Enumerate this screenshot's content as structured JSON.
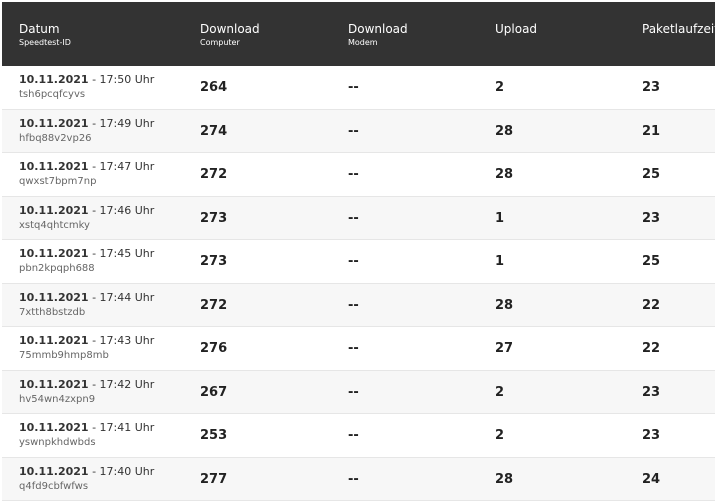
{
  "header": {
    "col_date": "Datum",
    "col_date_sub": "Speedtest-ID",
    "col_download_computer": "Download",
    "col_download_computer_sub": "Computer",
    "col_download_modem": "Download",
    "col_download_modem_sub": "Modem",
    "col_upload": "Upload",
    "col_ping": "Paketlaufzeit"
  },
  "rows": [
    {
      "date": "10.11.2021",
      "time": " - 17:50 Uhr",
      "id": "tsh6pcqfcyvs",
      "download": "264",
      "modem": "--",
      "upload": "2",
      "ping": "23"
    },
    {
      "date": "10.11.2021",
      "time": " - 17:49 Uhr",
      "id": "hfbq88v2vp26",
      "download": "274",
      "modem": "--",
      "upload": "28",
      "ping": "21"
    },
    {
      "date": "10.11.2021",
      "time": " - 17:47 Uhr",
      "id": "qwxst7bpm7np",
      "download": "272",
      "modem": "--",
      "upload": "28",
      "ping": "25"
    },
    {
      "date": "10.11.2021",
      "time": " - 17:46 Uhr",
      "id": "xstq4qhtcmky",
      "download": "273",
      "modem": "--",
      "upload": "1",
      "ping": "23"
    },
    {
      "date": "10.11.2021",
      "time": " - 17:45 Uhr",
      "id": "pbn2kpqph688",
      "download": "273",
      "modem": "--",
      "upload": "1",
      "ping": "25"
    },
    {
      "date": "10.11.2021",
      "time": " - 17:44 Uhr",
      "id": "7xtth8bstzdb",
      "download": "272",
      "modem": "--",
      "upload": "28",
      "ping": "22"
    },
    {
      "date": "10.11.2021",
      "time": " - 17:43 Uhr",
      "id": "75mmb9hmp8mb",
      "download": "276",
      "modem": "--",
      "upload": "27",
      "ping": "22"
    },
    {
      "date": "10.11.2021",
      "time": " - 17:42 Uhr",
      "id": "hv54wn4zxpn9",
      "download": "267",
      "modem": "--",
      "upload": "2",
      "ping": "23"
    },
    {
      "date": "10.11.2021",
      "time": " - 17:41 Uhr",
      "id": "yswnpkhdwbds",
      "download": "253",
      "modem": "--",
      "upload": "2",
      "ping": "23"
    },
    {
      "date": "10.11.2021",
      "time": " - 17:40 Uhr",
      "id": "q4fd9cbfwfws",
      "download": "277",
      "modem": "--",
      "upload": "28",
      "ping": "24"
    }
  ]
}
